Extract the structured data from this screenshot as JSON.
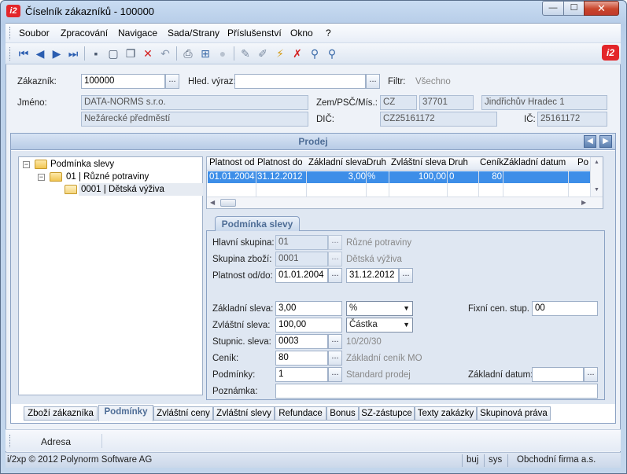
{
  "window": {
    "app_icon_text": "i2",
    "title": "Číselník zákazníků - 100000",
    "minimize": "—",
    "maximize": "☐",
    "close": "✕"
  },
  "menu": [
    "Soubor",
    "Zpracování",
    "Navigace",
    "Sada/Strany",
    "Příslušenství",
    "Okno",
    "?"
  ],
  "toolbar": {
    "icons": [
      "first-record-icon",
      "previous-record-icon",
      "next-record-icon",
      "last-record-icon",
      "save-icon",
      "new-record-icon",
      "copy-record-icon",
      "delete-icon",
      "undo-icon",
      "print-icon",
      "tree-structure-icon",
      "disabled-circle-icon",
      "edit-pen-icon",
      "pen-icon",
      "filter-icon",
      "remove-filter-icon",
      "search-icon",
      "search-advanced-icon"
    ],
    "glyphs": [
      "⏮",
      "◀",
      "▶",
      "⏭",
      "▪",
      "▢",
      "❐",
      "✕",
      "↶",
      "⎙",
      "⊞",
      "●",
      "✎",
      "✐",
      "⚡",
      "✗",
      "⚲",
      "⚲"
    ],
    "brand": "i2"
  },
  "header": {
    "zakaznik_label": "Zákazník:",
    "zakaznik_value": "100000",
    "hled_label": "Hled. výraz:",
    "hled_value": "",
    "filtr_label": "Filtr:",
    "filtr_value": "Všechno",
    "jmeno_label": "Jméno:",
    "jmeno_value": "DATA-NORMS s.r.o.",
    "jmeno2_value": "Nežárecké předměstí",
    "zem_label": "Zem/PSČ/Mís.:",
    "zem_value": "CZ",
    "psc_value": "37701",
    "misto_value": "Jindřichův Hradec 1",
    "dic_label": "DIČ:",
    "dic_value": "CZ25161172",
    "ic_label": "IČ:",
    "ic_value": "25161172",
    "dots": "..."
  },
  "prodej": {
    "title": "Prodej",
    "prev": "◀",
    "next": "▶"
  },
  "tree": {
    "root": "Podmínka slevy",
    "level1": "01  |  Různé potraviny",
    "level2": "0001  |  Dětská výživa",
    "collapse": "−"
  },
  "grid": {
    "columns": [
      "Platnost od",
      "Platnost do",
      "Základní sleva",
      "Druh",
      "Zvláštní sleva",
      "Druh",
      "Ceník",
      "Základní datum",
      "Po"
    ],
    "rows": [
      [
        "01.01.2004",
        "31.12.2012",
        "3,00",
        "%",
        "100,00",
        "0",
        "80",
        "",
        ""
      ]
    ],
    "scroll_up": "▲",
    "scroll_down": "▼",
    "scroll_left": "◀",
    "scroll_right": "▶"
  },
  "detail": {
    "tab_label": "Podmínka slevy",
    "hlavni_label": "Hlavní skupina:",
    "hlavni_value": "01",
    "hlavni_desc": "Různé potraviny",
    "skupina_label": "Skupina zboží:",
    "skupina_value": "0001",
    "skupina_desc": "Dětská výživa",
    "platnost_label": "Platnost od/do:",
    "platnost_od": "01.01.2004",
    "platnost_do": "31.12.2012",
    "zakl_label": "Základní sleva:",
    "zakl_value": "3,00",
    "zakl_druh": "%",
    "fixni_label": "Fixní cen. stup. :",
    "fixni_value": "00",
    "zvl_label": "Zvláštní sleva:",
    "zvl_value": "100,00",
    "zvl_druh": "Částka",
    "stupnic_label": "Stupnic. sleva:",
    "stupnic_value": "0003",
    "stupnic_desc": "10/20/30",
    "cenik_label": "Ceník:",
    "cenik_value": "80",
    "cenik_desc": "Základní ceník MO",
    "podminky_label": "Podmínky:",
    "podminky_value": "1",
    "podminky_desc": "Standard prodej",
    "zakl_datum_label": "Základní datum:",
    "zakl_datum_value": "",
    "poznamka_label": "Poznámka:",
    "poznamka_value": "",
    "dropdown_arrow": "▼"
  },
  "bottom_tabs": [
    "Zboží zákazníka",
    "Podmínky",
    "Zvláštní ceny",
    "Zvláštní slevy",
    "Refundace",
    "Bonus",
    "SZ-zástupce",
    "Texty zakázky",
    "Skupinová práva"
  ],
  "adresa": "Adresa",
  "status": {
    "copyright": "i/2xp © 2012 Polynorm Software AG",
    "user": "buj",
    "db": "sys",
    "company": "Obchodní firma a.s."
  }
}
